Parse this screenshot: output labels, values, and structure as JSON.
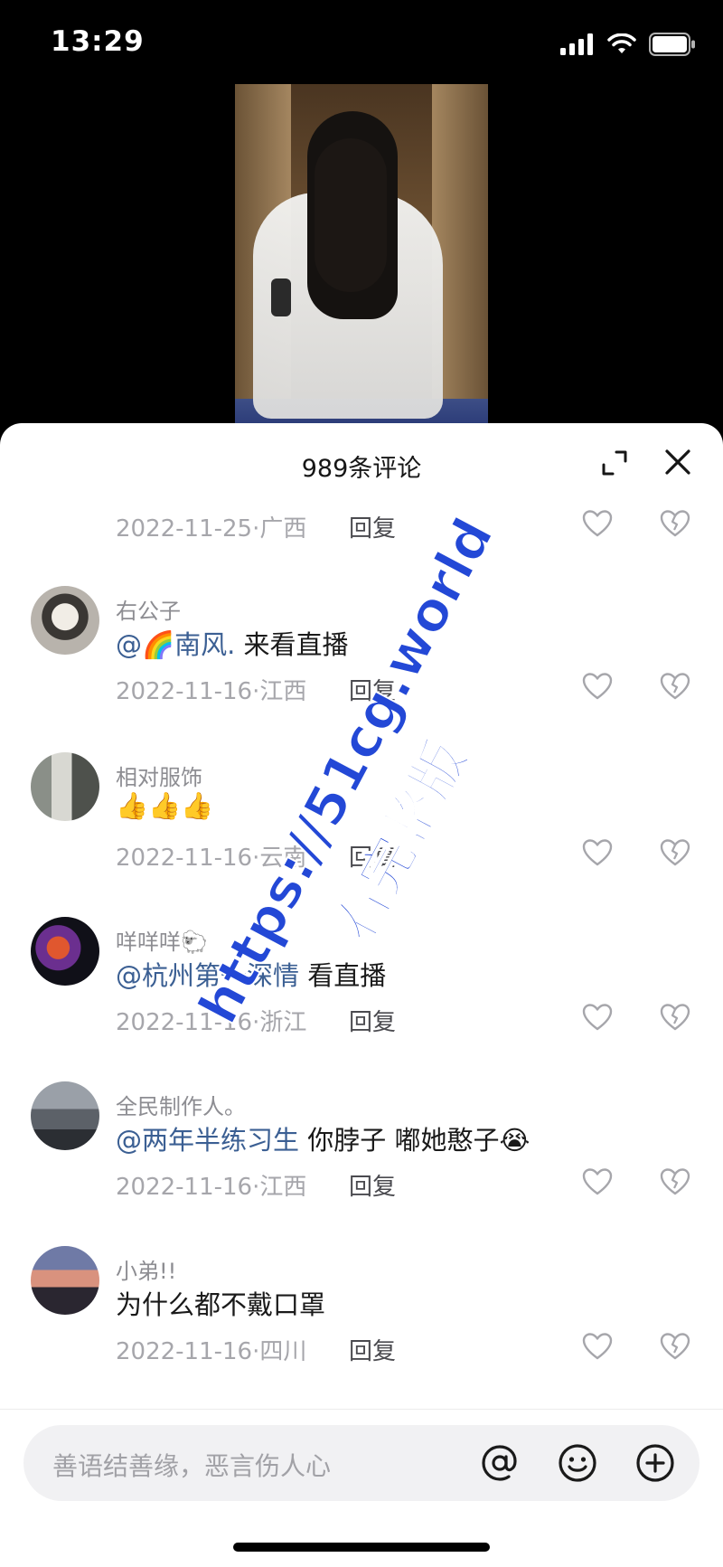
{
  "status_bar": {
    "time": "13:29",
    "icons": [
      "signal-icon",
      "wifi-icon",
      "battery-icon"
    ]
  },
  "sheet": {
    "title": "989条评论"
  },
  "top_partial": {
    "date": "2022-11-25",
    "location": "广西",
    "reply_label": "回复"
  },
  "comments": [
    {
      "user": "右公子",
      "mention": "@🌈南风.",
      "text": " 来看直播",
      "date": "2022-11-16",
      "location": "江西",
      "reply_label": "回复"
    },
    {
      "user": "相对服饰",
      "mention": "",
      "text": "👍👍👍",
      "date": "2022-11-16",
      "location": "云南",
      "reply_label": "回复"
    },
    {
      "user": "咩咩咩🐑",
      "mention": "@杭州第一深情",
      "text": " 看直播",
      "date": "2022-11-16",
      "location": "浙江",
      "reply_label": "回复"
    },
    {
      "user": "全民制作人。",
      "mention": "@两年半练习生",
      "text": " 你脖子 嘟她憨子😭",
      "date": "2022-11-16",
      "location": "江西",
      "reply_label": "回复"
    },
    {
      "user": "小弟!!",
      "mention": "",
      "text": "为什么都不戴口罩",
      "date": "2022-11-16",
      "location": "四川",
      "reply_label": "回复"
    }
  ],
  "input": {
    "placeholder": "善语结善缘，恶言伤人心"
  },
  "watermark": {
    "line1": "https://51cg.world",
    "line2": "看完整版"
  },
  "colors": {
    "mention": "#3b5f93",
    "watermark": "#2348d6"
  }
}
